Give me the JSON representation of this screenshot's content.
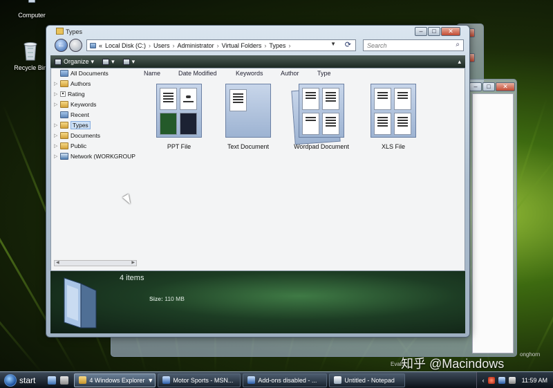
{
  "desktop": {
    "icons": [
      {
        "label": "Computer"
      },
      {
        "label": "Recycle Bin"
      }
    ],
    "watermark": "知乎 @Macindows",
    "eval_text": "Evalu",
    "build_hint": "onghorn"
  },
  "explorer": {
    "title": "Types",
    "address": {
      "prefix": "«",
      "segments": [
        "Local Disk (C:)",
        "Users",
        "Administrator",
        "Virtual Folders",
        "Types"
      ],
      "separator": "›"
    },
    "search_placeholder": "Search",
    "toolbar": {
      "organize_label": "Organize"
    },
    "nav_pane": [
      {
        "label": "All Documents",
        "icon": "folder-icon",
        "arrow": ""
      },
      {
        "label": "Authors",
        "icon": "folder-yellow-icon",
        "arrow": "▷"
      },
      {
        "label": "Rating",
        "icon": "checkbox-icon",
        "arrow": "▷"
      },
      {
        "label": "Keywords",
        "icon": "folder-yellow-icon",
        "arrow": "▷"
      },
      {
        "label": "Recent",
        "icon": "folder-icon",
        "arrow": ""
      },
      {
        "label": "Types",
        "icon": "folder-yellow-icon",
        "arrow": "▷",
        "selected": true
      },
      {
        "label": "Documents",
        "icon": "folder-yellow-icon",
        "arrow": "▷"
      },
      {
        "label": "Public",
        "icon": "folder-yellow-icon",
        "arrow": "▷"
      },
      {
        "label": "Network (WORKGROUP",
        "icon": "network-icon",
        "arrow": "▷"
      }
    ],
    "columns": [
      "Name",
      "Date Modified",
      "Keywords",
      "Author",
      "Type"
    ],
    "items": [
      {
        "label": "PPT File"
      },
      {
        "label": "Text Document"
      },
      {
        "label": "Wordpad Document"
      },
      {
        "label": "XLS File"
      }
    ],
    "details": {
      "count": "4 items",
      "size_label": "Size:",
      "size_value": "110 MB"
    }
  },
  "taskbar": {
    "start_label": "start",
    "tasks": [
      {
        "label": "4 Windows Explorer",
        "has_dropdown": true,
        "active": true
      },
      {
        "label": "Motor Sports - MSN..."
      },
      {
        "label": "Add-ons disabled - ..."
      },
      {
        "label": "Untitled - Notepad"
      }
    ],
    "tray_chevron": "‹",
    "clock": "11:59 AM"
  },
  "colors": {
    "accent": "#2c5ea8",
    "details_bg": "#1d3d24",
    "taskbar_bg": "#0b1118"
  }
}
